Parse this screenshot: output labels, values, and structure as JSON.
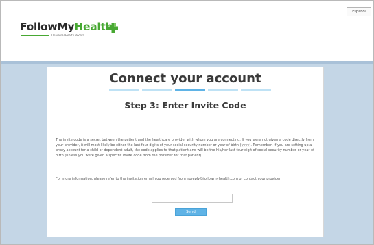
{
  "header": {
    "language_button": "Español",
    "logo": {
      "follow": "FollowMy",
      "health": "Health",
      "trademark": "®",
      "tagline": "Universal Health Record"
    }
  },
  "card": {
    "title": "Connect your account",
    "step_heading": "Step 3: Enter Invite Code",
    "steps_total": 5,
    "current_step": 3,
    "paragraph1": "The invite code is a secret between the patient and the healthcare provider with whom you are connecting. If you were not given a code directly from your provider, it will most likely be either the last four digits of your social security number or year of birth (yyyy). Remember, if you are setting up a proxy account for a child or dependent adult, the code applies to that patient and will be the his/her last four digit of social security number or year of birth (unless you were given a specific invite code from the provider for that patient).",
    "paragraph2": "For more information, please refer to the invitation email you received from noreply@followmyhealth.com or contact your provider.",
    "input_value": "",
    "send_label": "Send"
  },
  "colors": {
    "brand_green": "#48a833",
    "accent_blue": "#5fb3e6",
    "band_blue": "#c4d6e6"
  }
}
